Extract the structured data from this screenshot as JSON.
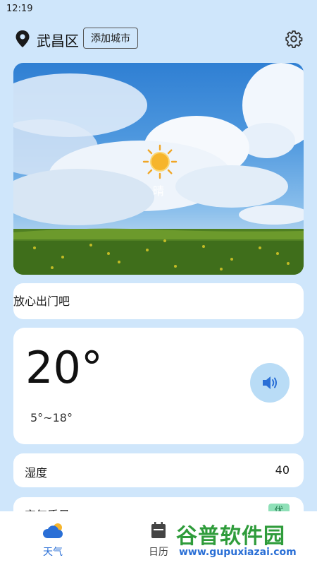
{
  "status_bar": {
    "time": "12:19"
  },
  "header": {
    "district": "武昌区",
    "add_city_label": "添加城市",
    "icons": {
      "location": "map-pin-icon",
      "settings": "gear-icon"
    }
  },
  "weather_card": {
    "condition": "晴",
    "icon": "sun-icon"
  },
  "tip": {
    "text": "放心出门吧"
  },
  "temperature": {
    "current": "20°",
    "range": "5°~18°",
    "voice_icon": "speaker-icon",
    "accent_color": "#2a6fd6"
  },
  "details": {
    "humidity_label": "湿度",
    "humidity_value": "40",
    "air_quality_label": "空气质量",
    "air_quality_badge": "优"
  },
  "tab_bar": {
    "tabs": [
      {
        "label": "天气",
        "icon": "cloud-sun-icon",
        "active": true
      },
      {
        "label": "日历",
        "icon": "calendar-icon",
        "active": false
      }
    ]
  },
  "watermark": {
    "text": "谷普软件园",
    "url": "www.gupuxiazai.com"
  }
}
